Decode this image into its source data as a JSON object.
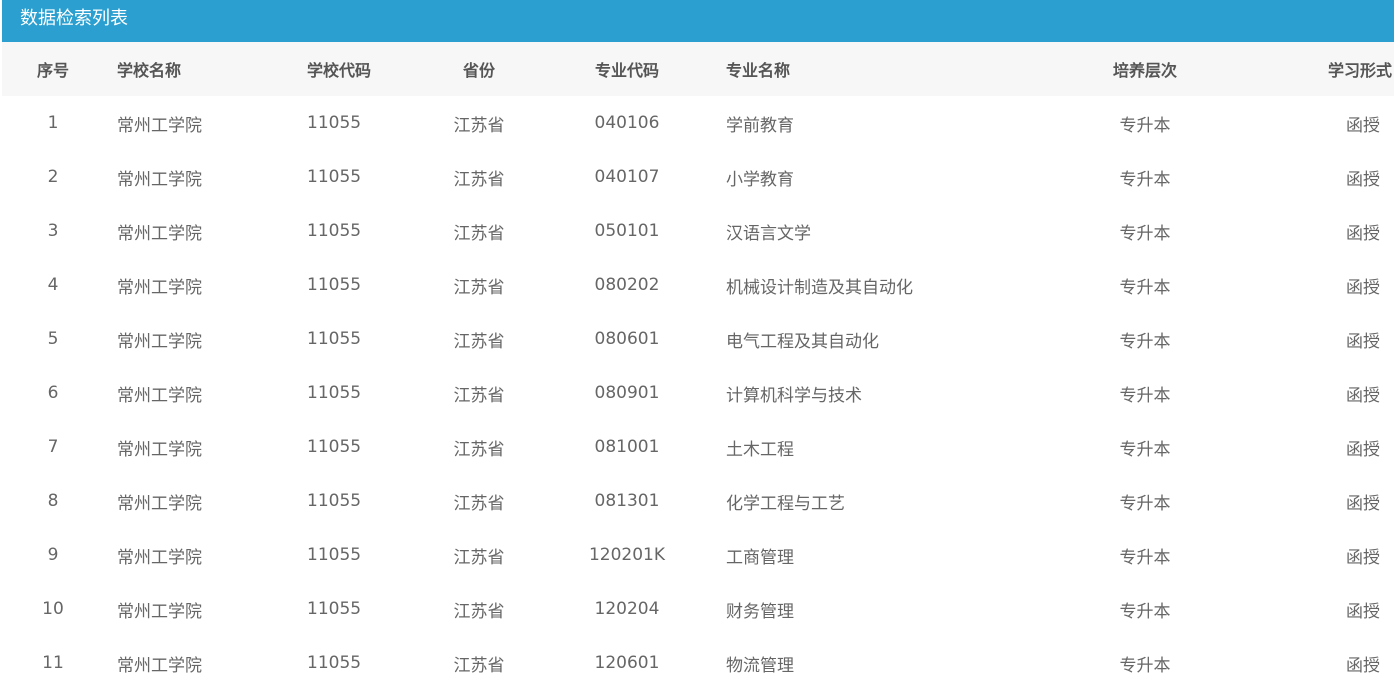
{
  "panel": {
    "title": "数据检索列表"
  },
  "table": {
    "columns": [
      "序号",
      "学校名称",
      "学校代码",
      "省份",
      "专业代码",
      "专业名称",
      "培养层次",
      "学习形式"
    ],
    "rows": [
      [
        "1",
        "常州工学院",
        "11055",
        "江苏省",
        "040106",
        "学前教育",
        "专升本",
        "函授"
      ],
      [
        "2",
        "常州工学院",
        "11055",
        "江苏省",
        "040107",
        "小学教育",
        "专升本",
        "函授"
      ],
      [
        "3",
        "常州工学院",
        "11055",
        "江苏省",
        "050101",
        "汉语言文学",
        "专升本",
        "函授"
      ],
      [
        "4",
        "常州工学院",
        "11055",
        "江苏省",
        "080202",
        "机械设计制造及其自动化",
        "专升本",
        "函授"
      ],
      [
        "5",
        "常州工学院",
        "11055",
        "江苏省",
        "080601",
        "电气工程及其自动化",
        "专升本",
        "函授"
      ],
      [
        "6",
        "常州工学院",
        "11055",
        "江苏省",
        "080901",
        "计算机科学与技术",
        "专升本",
        "函授"
      ],
      [
        "7",
        "常州工学院",
        "11055",
        "江苏省",
        "081001",
        "土木工程",
        "专升本",
        "函授"
      ],
      [
        "8",
        "常州工学院",
        "11055",
        "江苏省",
        "081301",
        "化学工程与工艺",
        "专升本",
        "函授"
      ],
      [
        "9",
        "常州工学院",
        "11055",
        "江苏省",
        "120201K",
        "工商管理",
        "专升本",
        "函授"
      ],
      [
        "10",
        "常州工学院",
        "11055",
        "江苏省",
        "120204",
        "财务管理",
        "专升本",
        "函授"
      ],
      [
        "11",
        "常州工学院",
        "11055",
        "江苏省",
        "120601",
        "物流管理",
        "专升本",
        "函授"
      ]
    ]
  },
  "colors": {
    "header_bg": "#2a9fd0",
    "table_head_bg": "#f7f7f7",
    "text": "#666666"
  }
}
